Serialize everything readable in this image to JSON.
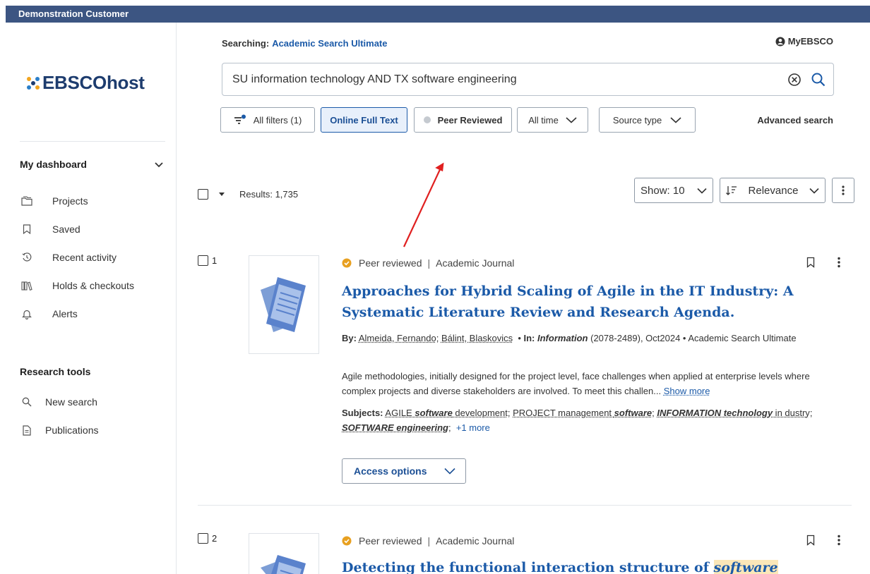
{
  "account": {
    "name": "Demonstration Customer"
  },
  "logo": {
    "text": "EBSCOhost"
  },
  "sidebar": {
    "dashboard_title": "My dashboard",
    "dashboard_items": [
      {
        "label": "Projects",
        "icon": "folder-icon"
      },
      {
        "label": "Saved",
        "icon": "bookmark-icon"
      },
      {
        "label": "Recent activity",
        "icon": "history-icon"
      },
      {
        "label": "Holds & checkouts",
        "icon": "books-icon"
      },
      {
        "label": "Alerts",
        "icon": "bell-icon"
      }
    ],
    "tools_title": "Research tools",
    "tools_items": [
      {
        "label": "New search",
        "icon": "search-icon"
      },
      {
        "label": "Publications",
        "icon": "document-icon"
      }
    ]
  },
  "header": {
    "searching_label": "Searching:",
    "database": "Academic Search Ultimate",
    "myebsco": "MyEBSCO"
  },
  "search": {
    "query": "SU information technology AND TX software engineering"
  },
  "filters": {
    "all_filters": "All filters (1)",
    "online_full_text": "Online Full Text",
    "peer_reviewed": "Peer Reviewed",
    "all_time": "All time",
    "source_type": "Source type",
    "advanced_search": "Advanced search"
  },
  "results": {
    "count_label": "Results: 1,735",
    "show": "Show: 10",
    "sort": "Relevance"
  },
  "items": [
    {
      "num": "1",
      "peer": "Peer reviewed",
      "type": "Academic Journal",
      "title_line1": "Approaches for Hybrid Scaling of Agile in the IT Industry: A",
      "title_line2": "Systematic Literature Review and Research Agenda.",
      "by_label": "By:",
      "author1": "Almeida, Fernando",
      "author2": "Bálint, Blaskovics",
      "in_label": "In:",
      "journal": "Information",
      "journal_info": "(2078-2489), Oct2024 • Academic Search Ultimate",
      "abstract": "Agile methodologies, initially designed for the project level, face challenges when applied at enterprise levels where complex projects and diverse stakeholders are involved. To meet this challen...",
      "show_more": "Show more",
      "subjects_label": "Subjects:",
      "subject1_a": "AGILE ",
      "subject1_b": "software",
      "subject1_c": " development",
      "subject2_a": "PROJECT management ",
      "subject2_b": "software",
      "subject3_a": "INFORMATION technology",
      "subject3_b": " in dustry",
      "subject4": "SOFTWARE engineering",
      "more_subjects": "+1 more",
      "access": "Access options"
    },
    {
      "num": "2",
      "peer": "Peer reviewed",
      "type": "Academic Journal",
      "title_a": "Detecting the functional interaction structure of ",
      "title_b": "software"
    }
  ]
}
